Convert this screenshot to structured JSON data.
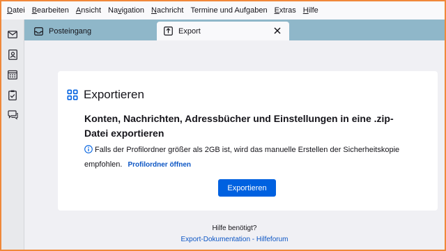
{
  "menubar": {
    "items": [
      {
        "label": "Datei",
        "accel": "D",
        "rest": "atei"
      },
      {
        "label": "Bearbeiten",
        "accel": "B",
        "rest": "earbeiten"
      },
      {
        "label": "Ansicht",
        "accel": "A",
        "rest": "nsicht"
      },
      {
        "label": "Navigation",
        "pre": "Na",
        "accel": "v",
        "rest": "igation"
      },
      {
        "label": "Nachricht",
        "accel": "N",
        "rest": "achricht"
      },
      {
        "label": "Termine und Aufgaben",
        "pre": "Termine und Aufgaben",
        "accel": "",
        "rest": ""
      },
      {
        "label": "Extras",
        "accel": "E",
        "rest": "xtras"
      },
      {
        "label": "Hilfe",
        "accel": "H",
        "rest": "ilfe"
      }
    ]
  },
  "spaces": {
    "icons": [
      "mail-icon",
      "address-book-icon",
      "calendar-icon",
      "tasks-icon",
      "chat-icon"
    ]
  },
  "tabs": [
    {
      "label": "Posteingang",
      "icon": "inbox-icon",
      "active": false
    },
    {
      "label": "Export",
      "icon": "export-icon",
      "active": true
    }
  ],
  "card": {
    "title": "Exportieren",
    "heading": "Konten, Nachrichten, Adressbücher und Einstellungen in eine .zip-Datei exportieren",
    "info": "Falls der Profilordner größer als 2GB ist, wird das manuelle Erstellen der Sicherheitskopie empfohlen.",
    "info_link": "Profilordner öffnen",
    "button": "Exportieren"
  },
  "help": {
    "question": "Hilfe benötigt?",
    "link1": "Export-Dokumentation",
    "separator": " - ",
    "link2": "Hilfeforum"
  },
  "colors": {
    "accent": "#0061e0",
    "tabbar": "#8fb7c9",
    "border": "#f0883a",
    "link": "#0b55c4"
  }
}
